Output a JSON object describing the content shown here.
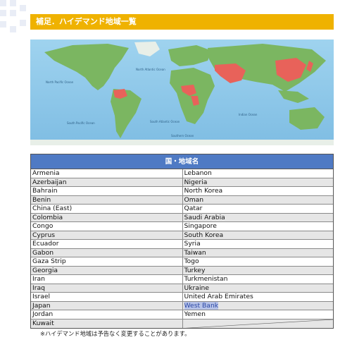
{
  "header": {
    "title": "補足．ハイデマンド地域一覧"
  },
  "map": {
    "ocean_color": "#8fc8ea",
    "land_color": "#7bb661",
    "highlight_color": "#e8625a",
    "labels": [
      "North Pacific Ocean",
      "North Atlantic Ocean",
      "South Pacific Ocean",
      "South Atlantic Ocean",
      "Indian Ocean",
      "Southern Ocean"
    ]
  },
  "table": {
    "header": "国・地域名",
    "rows": [
      [
        "Armenia",
        "Lebanon"
      ],
      [
        "Azerbaijan",
        "Nigeria"
      ],
      [
        "Bahrain",
        "North Korea"
      ],
      [
        "Benin",
        "Oman"
      ],
      [
        "China (East)",
        "Qatar"
      ],
      [
        "Colombia",
        "Saudi Arabia"
      ],
      [
        "Congo",
        "Singapore"
      ],
      [
        "Cyprus",
        "South Korea"
      ],
      [
        "Ecuador",
        "Syria"
      ],
      [
        "Gabon",
        "Taiwan"
      ],
      [
        "Gaza Strip",
        "Togo"
      ],
      [
        "Georgia",
        "Turkey"
      ],
      [
        "Iran",
        "Turkmenistan"
      ],
      [
        "Iraq",
        "Ukraine"
      ],
      [
        "Israel",
        "United Arab Emirates"
      ],
      [
        "Japan",
        "West Bank"
      ],
      [
        "Jordan",
        "Yemen"
      ],
      [
        "Kuwait",
        ""
      ]
    ]
  },
  "footnote": "※ハイデマンド地域は予告なく変更することがあります。"
}
